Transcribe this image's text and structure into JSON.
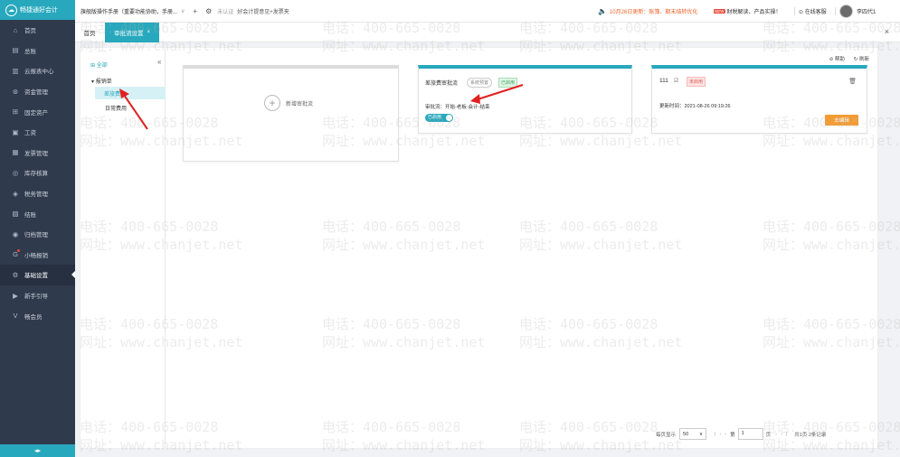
{
  "sidebar": {
    "brand": "畅捷通好会计",
    "items": [
      {
        "icon": "home-icon",
        "glyph": "⌂",
        "label": "首页"
      },
      {
        "icon": "ledger-icon",
        "glyph": "▤",
        "label": "总账"
      },
      {
        "icon": "report-icon",
        "glyph": "▥",
        "label": "云报表中心"
      },
      {
        "icon": "money-icon",
        "glyph": "⊛",
        "label": "资金管理"
      },
      {
        "icon": "asset-icon",
        "glyph": "⊞",
        "label": "固定资产"
      },
      {
        "icon": "salary-icon",
        "glyph": "▣",
        "label": "工资"
      },
      {
        "icon": "invoice-icon",
        "glyph": "▦",
        "label": "发票管理"
      },
      {
        "icon": "stock-icon",
        "glyph": "◎",
        "label": "库存核算"
      },
      {
        "icon": "tax-icon",
        "glyph": "◈",
        "label": "税务管理"
      },
      {
        "icon": "closing-icon",
        "glyph": "▧",
        "label": "结账"
      },
      {
        "icon": "archive-icon",
        "glyph": "◉",
        "label": "归档管理"
      },
      {
        "icon": "mini-report-icon",
        "glyph": "G",
        "label": "小畅报销"
      },
      {
        "icon": "settings-icon",
        "glyph": "⚙",
        "label": "基础设置"
      },
      {
        "icon": "guide-icon",
        "glyph": "▶",
        "label": "新手引导"
      },
      {
        "icon": "vip-icon",
        "glyph": "V",
        "label": "畅会员"
      }
    ],
    "active_index": 12
  },
  "topbar": {
    "company": "旗舰版操作手册（重要功能协助，手册...",
    "cert_label": "未认证",
    "feedback_label": "好会计提意见+发票夹",
    "notice": "10月26日更新：账簿、期末结转优化",
    "news_badge": "NEW",
    "news": "财税解读、产品实操！",
    "service": "在线客服",
    "username": "李四代1"
  },
  "tabs": {
    "home": "首页",
    "approval": "审批流设置",
    "approval_close": "×",
    "close_all": "×"
  },
  "tree": {
    "all": "全部",
    "collapse": "«",
    "group": "报销单",
    "selected": "差旅费",
    "daily": "日常费用"
  },
  "toolbar": {
    "help": "帮助",
    "refresh": "刷新"
  },
  "add_card": {
    "label": "新增审批流"
  },
  "cards": [
    {
      "title": "差旅费审批流",
      "preset_tag": "系统预置",
      "status_tag": "已启用",
      "flow_text": "审批流：开始-老板-会计-结束",
      "toggle_label": "已启用"
    },
    {
      "title": "111",
      "status_tag": "未启用",
      "update_text": "更新时间：2021-08-26 09:19:26",
      "edit_button": "去编辑"
    }
  ],
  "pager": {
    "per_page_label": "每页显示",
    "per_page": "50",
    "page_prefix": "第",
    "page": "1",
    "page_suffix": "页",
    "total": "共1页  2条记录"
  },
  "watermark": {
    "phone": "电话：400-665-0028",
    "site": "网址：www.chanjet.net"
  },
  "colors": {
    "accent": "#28a8bd",
    "sidebar": "#2f3a4c",
    "orange": "#f39c33",
    "arrow": "#e02020"
  }
}
